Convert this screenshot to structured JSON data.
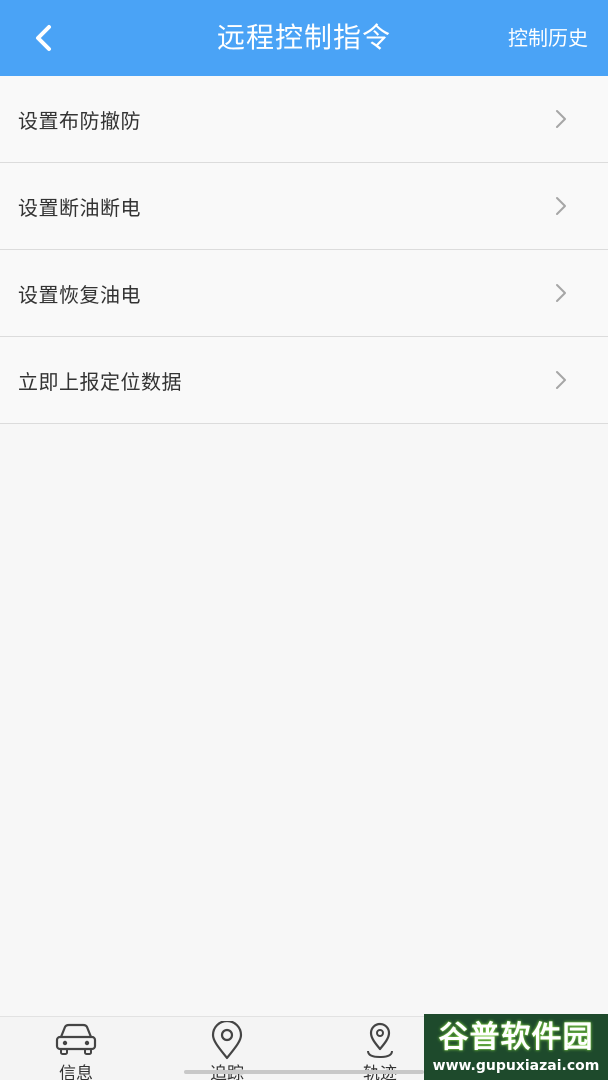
{
  "header": {
    "title": "远程控制指令",
    "history_label": "控制历史"
  },
  "menu": {
    "items": [
      {
        "label": "设置布防撤防"
      },
      {
        "label": "设置断油断电"
      },
      {
        "label": "设置恢复油电"
      },
      {
        "label": "立即上报定位数据"
      }
    ]
  },
  "bottom_nav": {
    "items": [
      {
        "label": "信息",
        "icon": "car-icon"
      },
      {
        "label": "追踪",
        "icon": "location-pin-icon"
      },
      {
        "label": "轨迹",
        "icon": "track-pin-icon"
      }
    ]
  },
  "watermark": {
    "brand": "谷普软件园",
    "url": "www.gupuxiazai.com"
  },
  "colors": {
    "header_bg": "#4aa3f6",
    "page_bg": "#f7f7f7",
    "divider": "#dcdcdc",
    "text": "#333333",
    "chevron": "#a6a6a6"
  }
}
